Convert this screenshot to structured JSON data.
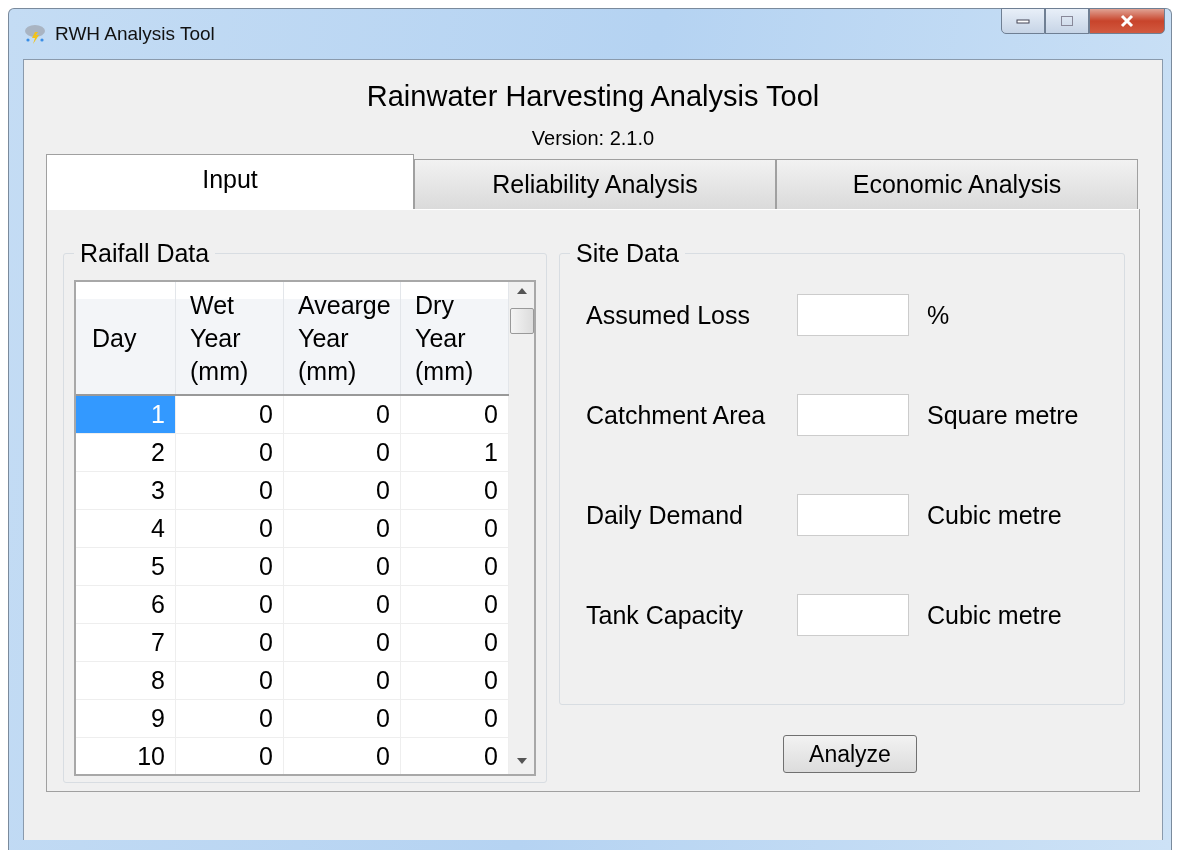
{
  "window": {
    "title": "RWH Analysis Tool"
  },
  "heading": "Rainwater Harvesting Analysis Tool",
  "version": "Version: 2.1.0",
  "tabs": [
    {
      "label": "Input",
      "selected": true
    },
    {
      "label": "Reliability Analysis",
      "selected": false
    },
    {
      "label": "Economic Analysis",
      "selected": false
    }
  ],
  "rainfall": {
    "title": "Raifall Data",
    "columns": [
      "Day",
      "Wet Year (mm)",
      "Avearge Year (mm)",
      "Dry Year (mm)"
    ],
    "rows": [
      {
        "cells": [
          "1",
          "0",
          "0",
          "0"
        ],
        "selected": true
      },
      {
        "cells": [
          "2",
          "0",
          "0",
          "1"
        ],
        "selected": false
      },
      {
        "cells": [
          "3",
          "0",
          "0",
          "0"
        ],
        "selected": false
      },
      {
        "cells": [
          "4",
          "0",
          "0",
          "0"
        ],
        "selected": false
      },
      {
        "cells": [
          "5",
          "0",
          "0",
          "0"
        ],
        "selected": false
      },
      {
        "cells": [
          "6",
          "0",
          "0",
          "0"
        ],
        "selected": false
      },
      {
        "cells": [
          "7",
          "0",
          "0",
          "0"
        ],
        "selected": false
      },
      {
        "cells": [
          "8",
          "0",
          "0",
          "0"
        ],
        "selected": false
      },
      {
        "cells": [
          "9",
          "0",
          "0",
          "0"
        ],
        "selected": false
      },
      {
        "cells": [
          "10",
          "0",
          "0",
          "0"
        ],
        "selected": false
      }
    ]
  },
  "site": {
    "title": "Site Data",
    "fields": [
      {
        "label": "Assumed Loss",
        "unit": "%"
      },
      {
        "label": "Catchment Area",
        "unit": "Square metre"
      },
      {
        "label": "Daily Demand",
        "unit": "Cubic metre"
      },
      {
        "label": "Tank Capacity",
        "unit": "Cubic metre"
      }
    ]
  },
  "button": "Analyze"
}
